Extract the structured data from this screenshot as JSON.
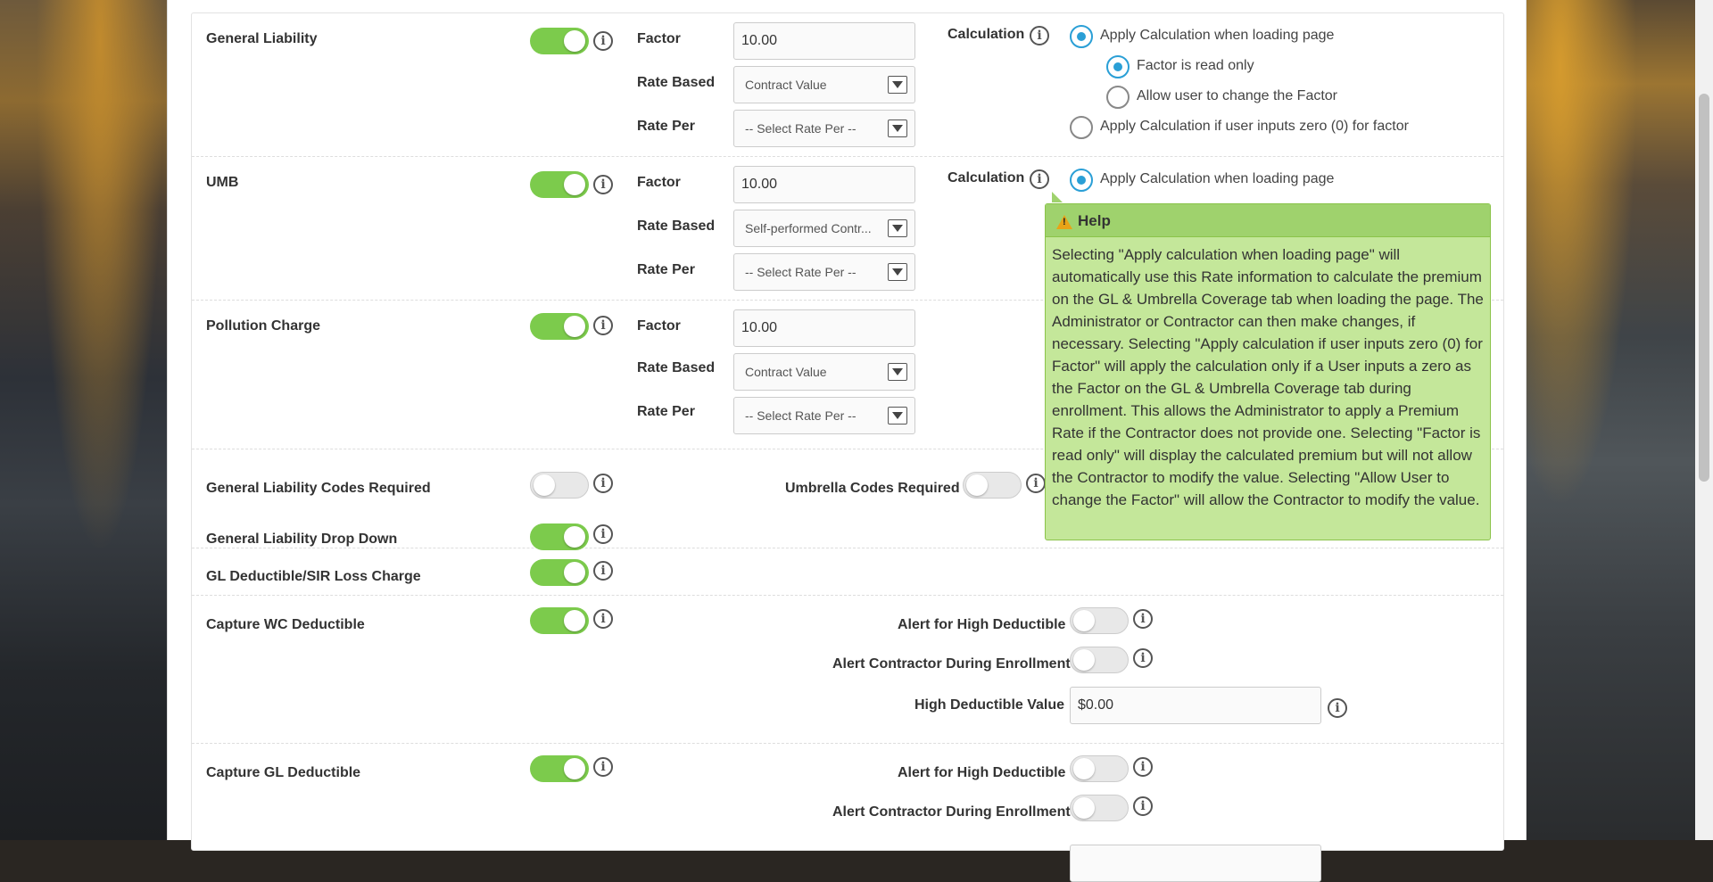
{
  "rows": {
    "gl": {
      "label": "General Liability",
      "factor_label": "Factor",
      "factor_value": "10.00",
      "rate_based_label": "Rate Based",
      "rate_based_value": "Contract Value",
      "rate_per_label": "Rate Per",
      "rate_per_value": "-- Select Rate Per --",
      "calculation_label": "Calculation",
      "opt_apply_loading": "Apply Calculation when loading page",
      "opt_read_only": "Factor is read only",
      "opt_allow_change": "Allow user to change the Factor",
      "opt_apply_zero": "Apply Calculation if user inputs zero (0) for factor"
    },
    "umb": {
      "label": "UMB",
      "factor_label": "Factor",
      "factor_value": "10.00",
      "rate_based_label": "Rate Based",
      "rate_based_value": "Self-performed Contr...",
      "rate_per_label": "Rate Per",
      "rate_per_value": "-- Select Rate Per --",
      "calculation_label": "Calculation",
      "opt_apply_loading": "Apply Calculation when loading page"
    },
    "pollution": {
      "label": "Pollution Charge",
      "factor_label": "Factor",
      "factor_value": "10.00",
      "rate_based_label": "Rate Based",
      "rate_based_value": "Contract Value",
      "rate_per_label": "Rate Per",
      "rate_per_value": "-- Select Rate Per --"
    },
    "codes": {
      "gl_codes_label": "General Liability Codes Required",
      "umb_codes_label": "Umbrella Codes Required",
      "gl_dropdown_label": "General Liability Drop Down"
    },
    "gl_deductible": {
      "label": "GL Deductible/SIR Loss Charge"
    },
    "wc_deductible": {
      "label": "Capture WC Deductible",
      "alert_high_label": "Alert for High Deductible",
      "alert_contractor_label": "Alert Contractor During Enrollment",
      "high_value_label": "High Deductible Value",
      "high_value": "$0.00"
    },
    "gl_capture_deductible": {
      "label": "Capture GL Deductible",
      "alert_high_label": "Alert for High Deductible",
      "alert_contractor_label": "Alert Contractor During Enrollment"
    }
  },
  "toggles": {
    "gl": "on",
    "umb": "on",
    "pollution": "on",
    "gl_codes": "off",
    "umb_codes": "off",
    "gl_dropdown": "on",
    "gl_deductible": "on",
    "wc_deductible": "on",
    "wc_alert_high": "off",
    "wc_alert_contractor": "off",
    "gl_capture": "on",
    "gl_alert_high": "off",
    "gl_alert_contractor": "off"
  },
  "help_popup": {
    "title": "Help",
    "body": "Selecting \"Apply calculation when loading page\" will automatically use this Rate information to calculate the premium on the GL & Umbrella Coverage tab when loading the page. The Administrator or Contractor can then make changes, if necessary. Selecting \"Apply calculation if user inputs zero (0) for Factor\" will apply the calculation only if a User inputs a zero as the Factor on the GL & Umbrella Coverage tab during enrollment. This allows the Administrator to apply a Premium Rate if the Contractor does not provide one. Selecting \"Factor is read only\" will display the calculated premium but will not allow the Contractor to modify the value. Selecting \"Allow User to change the Factor\" will allow the Contractor to modify the value."
  },
  "colors": {
    "toggle_on": "#7ccb4c",
    "radio_selected": "#2a9fd6",
    "help_bg": "#c4e79a",
    "help_header": "#9fd26d"
  }
}
